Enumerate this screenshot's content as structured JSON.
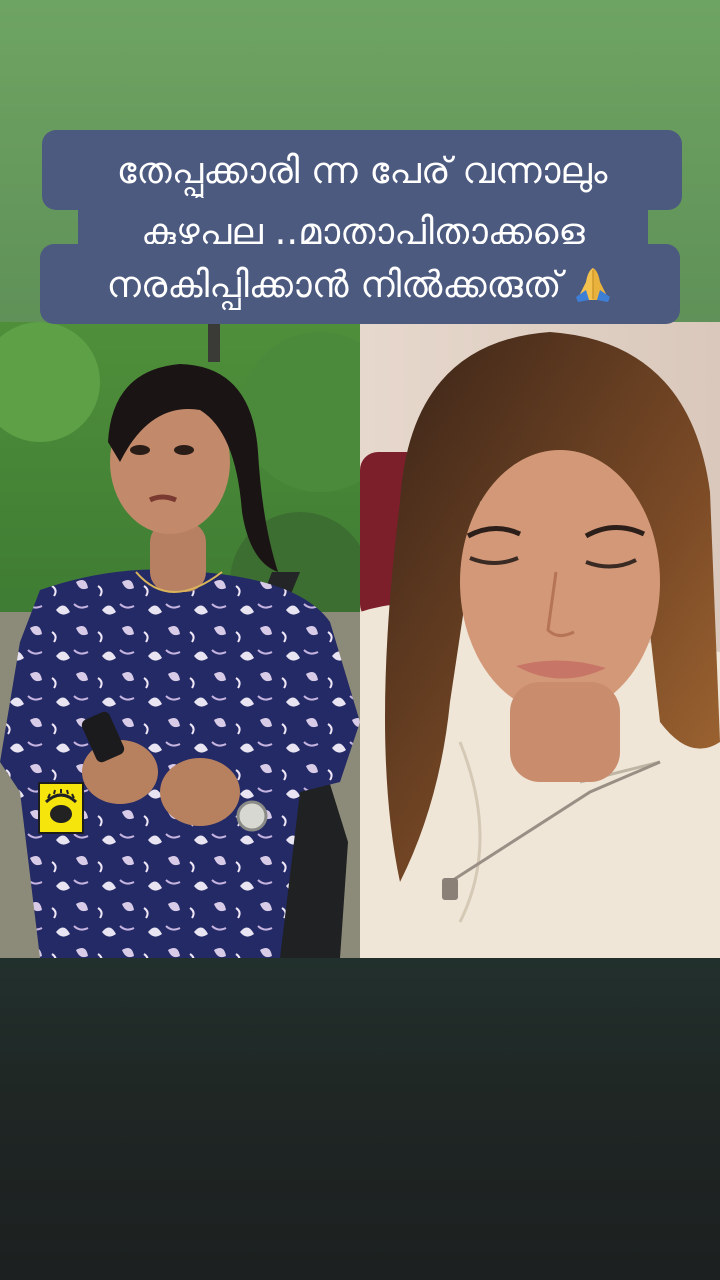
{
  "story": {
    "caption_lines": [
      "തേപ്പുക്കാരി ന്ന പേര് വന്നാലും",
      "കുഴപ്പല്ല ..മാതാപിതാക്കളെ",
      "നരകിപ്പിക്കാൻ നിൽക്കരുത്"
    ],
    "caption_emoji": "folded-hands-icon",
    "caption_bg_color": "#4d5a80",
    "top_bg_color": "#66995c",
    "bottom_bg_color": "#1f2624"
  },
  "panels": {
    "left": {
      "watermark_logo": "channel-logo-icon"
    },
    "right": {}
  }
}
